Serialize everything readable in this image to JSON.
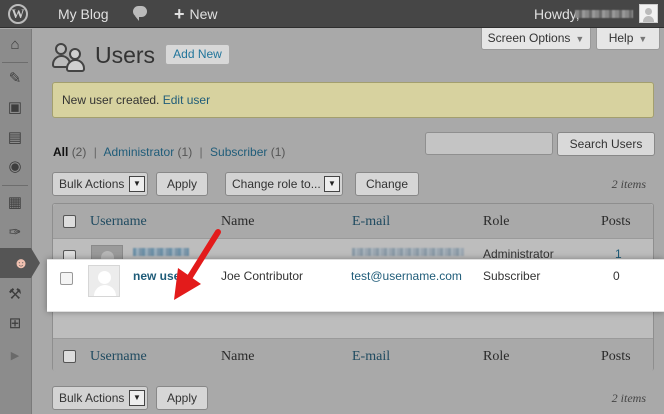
{
  "admin_bar": {
    "logo_glyph": "W",
    "site_name": "My Blog",
    "new_label": "New",
    "howdy_label": "Howdy,"
  },
  "sidebar": {
    "items": [
      {
        "name": "dashboard-icon",
        "glyph": "⌂"
      },
      {
        "name": "posts-icon",
        "glyph": "✎"
      },
      {
        "name": "media-icon",
        "glyph": "▣"
      },
      {
        "name": "pages-icon",
        "glyph": "▤"
      },
      {
        "name": "comments-icon",
        "glyph": "◉"
      },
      {
        "name": "appearance-icon",
        "glyph": "▦"
      },
      {
        "name": "plugins-icon",
        "glyph": "✑"
      },
      {
        "name": "users-icon",
        "glyph": "☻"
      },
      {
        "name": "tools-icon",
        "glyph": "⚒"
      },
      {
        "name": "settings-icon",
        "glyph": "⊞"
      },
      {
        "name": "collapse-icon",
        "glyph": "▶"
      }
    ]
  },
  "header": {
    "title": "Users",
    "add_new_label": "Add New",
    "screen_options_label": "Screen Options",
    "help_label": "Help"
  },
  "notice": {
    "text": "New user created.",
    "link_label": "Edit user"
  },
  "filters": {
    "all_label": "All",
    "all_count": "(2)",
    "admin_label": "Administrator",
    "admin_count": "(1)",
    "subscriber_label": "Subscriber",
    "subscriber_count": "(1)",
    "separator": "|"
  },
  "search": {
    "placeholder": "",
    "button_label": "Search Users"
  },
  "tablenav_top": {
    "bulk_actions_label": "Bulk Actions",
    "apply_label": "Apply",
    "change_role_label": "Change role to...",
    "change_label": "Change",
    "items_count": "2 items"
  },
  "tablenav_bottom": {
    "bulk_actions_label": "Bulk Actions",
    "apply_label": "Apply",
    "items_count": "2 items"
  },
  "table": {
    "columns": [
      "Username",
      "Name",
      "E-mail",
      "Role",
      "Posts"
    ],
    "rows": [
      {
        "username": "",
        "name": "",
        "email": "",
        "role": "Administrator",
        "posts": "1"
      },
      {
        "username": "new user",
        "name": "Joe Contributor",
        "email": "test@username.com",
        "role": "Subscriber",
        "posts": "0"
      }
    ]
  },
  "colors": {
    "admin_bar_bg": "#464646",
    "link_blue": "#1f5c79",
    "notice_bg": "#d7d29f",
    "highlight_row_bg": "#ffffff",
    "annotation_arrow": "#e31b1b"
  }
}
